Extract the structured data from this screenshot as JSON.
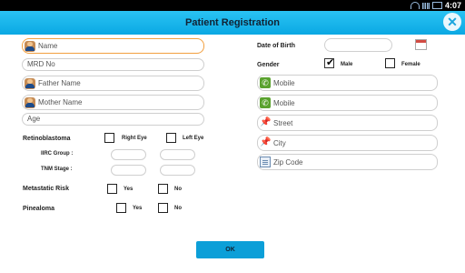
{
  "status": {
    "time": "4:07"
  },
  "header": {
    "title": "Patient Registration"
  },
  "left": {
    "name_placeholder": "Name",
    "mrd_placeholder": "MRD No",
    "father_placeholder": "Father Name",
    "mother_placeholder": "Mother Name",
    "age_placeholder": "Age",
    "retinoblastoma_label": "Retinoblastoma",
    "right_eye_label": "Right Eye",
    "left_eye_label": "Left Eye",
    "iirc_label": "IIRC Group :",
    "tnm_label": "TNM Stage :",
    "metastatic_label": "Metastatic Risk",
    "pinealoma_label": "Pinealoma",
    "yes_label": "Yes",
    "no_label": "No"
  },
  "right": {
    "dob_label": "Date of Birth",
    "gender_label": "Gender",
    "male_label": "Male",
    "female_label": "Female",
    "mobile1_placeholder": "Mobile",
    "mobile2_placeholder": "Mobile",
    "street_placeholder": "Street",
    "city_placeholder": "City",
    "zip_placeholder": "Zip Code"
  },
  "footer": {
    "ok_label": "OK"
  },
  "colors": {
    "accent": "#0aa8e3",
    "active_border": "#f2a040"
  }
}
